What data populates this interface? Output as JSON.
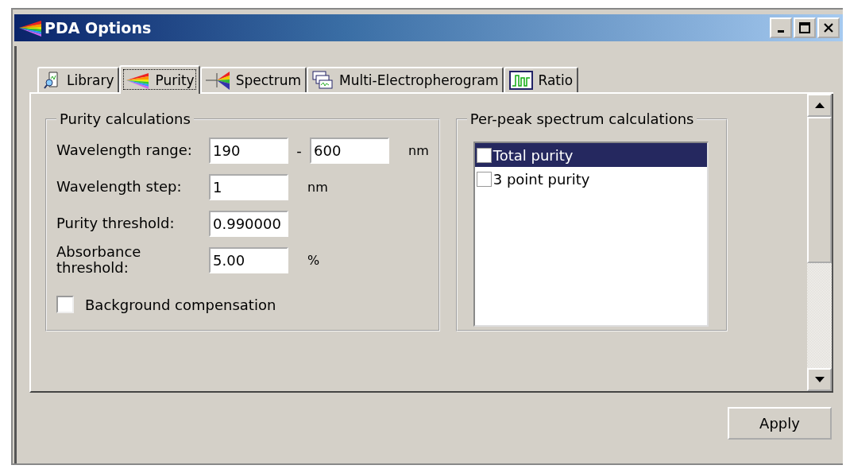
{
  "window": {
    "title": "PDA Options"
  },
  "tabs": [
    {
      "label": "Library",
      "kind": "library",
      "selected": false
    },
    {
      "label": "Purity",
      "kind": "purity",
      "selected": true
    },
    {
      "label": "Spectrum",
      "kind": "spectrum",
      "selected": false
    },
    {
      "label": "Multi-Electropherogram",
      "kind": "multi",
      "selected": false
    },
    {
      "label": "Ratio",
      "kind": "ratio",
      "selected": false
    }
  ],
  "purity_calculations": {
    "title": "Purity calculations",
    "rows": [
      {
        "label": "Wavelength range:",
        "values": [
          "190",
          "600"
        ],
        "separator": "-",
        "unit": "nm"
      },
      {
        "label": "Wavelength step:",
        "values": [
          "1"
        ],
        "unit": "nm"
      },
      {
        "label": "Purity threshold:",
        "values": [
          "0.990000"
        ]
      },
      {
        "label": "Absorbance threshold:",
        "values": [
          "5.00"
        ],
        "unit": "%"
      }
    ],
    "checkbox": {
      "label": "Background compensation",
      "checked": false
    }
  },
  "per_peak": {
    "title": "Per-peak spectrum calculations",
    "items": [
      {
        "label": "Total purity",
        "checked": false,
        "selected": true
      },
      {
        "label": "3 point purity",
        "checked": false,
        "selected": false
      }
    ]
  },
  "buttons": [
    {
      "label": "Apply"
    }
  ]
}
